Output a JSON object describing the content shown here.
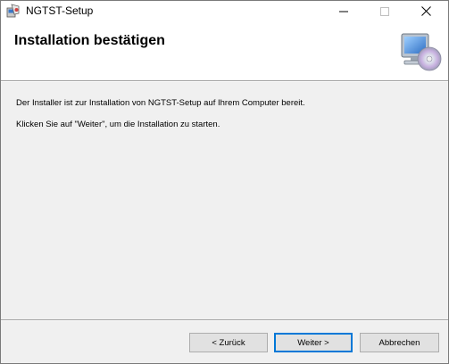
{
  "window": {
    "title": "NGTST-Setup",
    "controls": {
      "minimize": "—",
      "maximize": "☐",
      "close": "✕"
    }
  },
  "banner": {
    "title": "Installation bestätigen",
    "icon": "computer-cd-icon"
  },
  "messages": [
    "Der Installer ist zur Installation von NGTST-Setup auf Ihrem Computer bereit.",
    "Klicken Sie auf \"Weiter\", um die Installation zu starten."
  ],
  "buttons": {
    "back": "< Zurück",
    "next": "Weiter >",
    "cancel": "Abbrechen"
  },
  "colors": {
    "focus_border": "#0078d7",
    "button_face": "#e1e1e1",
    "dialog_bg": "#f0f0f0"
  }
}
